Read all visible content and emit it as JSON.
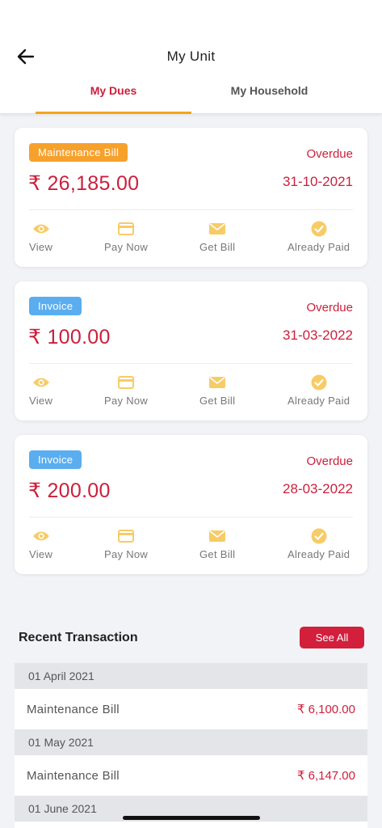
{
  "header": {
    "title": "My Unit"
  },
  "tabs": [
    {
      "label": "My Dues",
      "active": true
    },
    {
      "label": "My Household",
      "active": false
    }
  ],
  "dues": [
    {
      "badge": "Maintenance Bill",
      "badge_color": "#f6a12b",
      "status": "Overdue",
      "amount": "₹ 26,185.00",
      "date": "31-10-2021"
    },
    {
      "badge": "Invoice",
      "badge_color": "#5aaef0",
      "status": "Overdue",
      "amount": "₹ 100.00",
      "date": "31-03-2022"
    },
    {
      "badge": "Invoice",
      "badge_color": "#5aaef0",
      "status": "Overdue",
      "amount": "₹ 200.00",
      "date": "28-03-2022"
    }
  ],
  "actions": {
    "view": "View",
    "pay_now": "Pay Now",
    "get_bill": "Get Bill",
    "already_paid": "Already Paid"
  },
  "recent": {
    "title": "Recent Transaction",
    "see_all": "See All",
    "transactions": [
      {
        "date": "01 April 2021",
        "name": "Maintenance Bill",
        "amount": "₹ 6,100.00"
      },
      {
        "date": "01 May 2021",
        "name": "Maintenance Bill",
        "amount": "₹ 6,147.00"
      },
      {
        "date": "01 June 2021"
      }
    ]
  },
  "colors": {
    "accent": "#cc1f3c",
    "tab_indicator": "#f4a51c",
    "icon": "#f7cc66"
  },
  "icons": [
    "arrow-left-icon",
    "eye-icon",
    "card-icon",
    "mail-icon",
    "check-circle-icon"
  ]
}
